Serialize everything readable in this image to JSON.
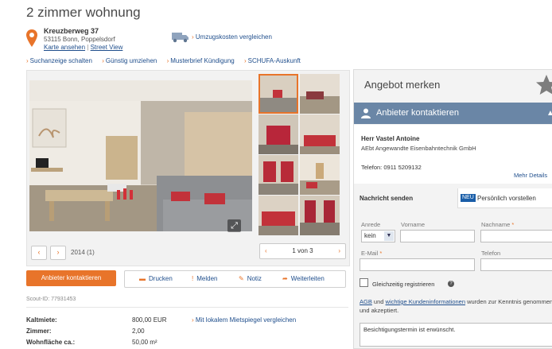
{
  "listing": {
    "title": "2 zimmer wohnung",
    "street": "Kreuzberweg 37",
    "city": "53115 Bonn, Poppelsdorf",
    "map_link": "Karte ansehen",
    "streetview_link": "Street View",
    "moving_cost_link": "Umzugskosten vergleichen"
  },
  "nav_links": [
    "Suchanzeige schalten",
    "Günstig umziehen",
    "Musterbrief Kündigung",
    "SCHUFA-Auskunft"
  ],
  "gallery": {
    "year_label": "2014 (1)",
    "pager_text": "1 von 3",
    "prev_symbol": "‹",
    "next_symbol": "›",
    "expand_symbol": "⤢"
  },
  "actions": {
    "contact_button": "Anbieter kontaktieren",
    "print": "Drucken",
    "report": "Melden",
    "note": "Notiz",
    "forward": "Weiterleiten"
  },
  "scout_id": "Scout-ID: 77931453",
  "details": [
    {
      "label": "Kaltmiete:",
      "value": "800,00 EUR"
    },
    {
      "label": "Zimmer:",
      "value": "2,00"
    },
    {
      "label": "Wohnfläche ca.:",
      "value": "50,00 m²"
    }
  ],
  "rent_compare_link": "Mit lokalem Mietspiegel vergleichen",
  "sidebar": {
    "merken": "Angebot merken",
    "contact_header": "Anbieter kontaktieren",
    "contact_name": "Herr Vastel Antoine",
    "contact_company": "AEbt Angewandte Eisenbahntechnik GmbH",
    "contact_phone": "Telefon: 0911 5209132",
    "more_details": "Mehr Details",
    "tab_send": "Nachricht senden",
    "tab_new_badge": "NEU",
    "tab_intro": "Persönlich vorstellen",
    "form": {
      "anrede_label": "Anrede",
      "anrede_value": "kein",
      "vorname_label": "Vorname",
      "nachname_label": "Nachname",
      "email_label": "E-Mail",
      "telefon_label": "Telefon",
      "required_mark": "*",
      "register_label": "Gleichzeitig registrieren",
      "terms_link_1": "AGB",
      "terms_text_1": " und ",
      "terms_link_2": "wichtige Kundeninformationen",
      "terms_text_2": " wurden zur Kenntnis genommen und akzeptiert.",
      "message_text": "Besichtigungstermin ist erwünscht."
    }
  },
  "colors": {
    "accent": "#e8742a",
    "link": "#1f4e8c",
    "panel_header": "#6a86a6"
  }
}
